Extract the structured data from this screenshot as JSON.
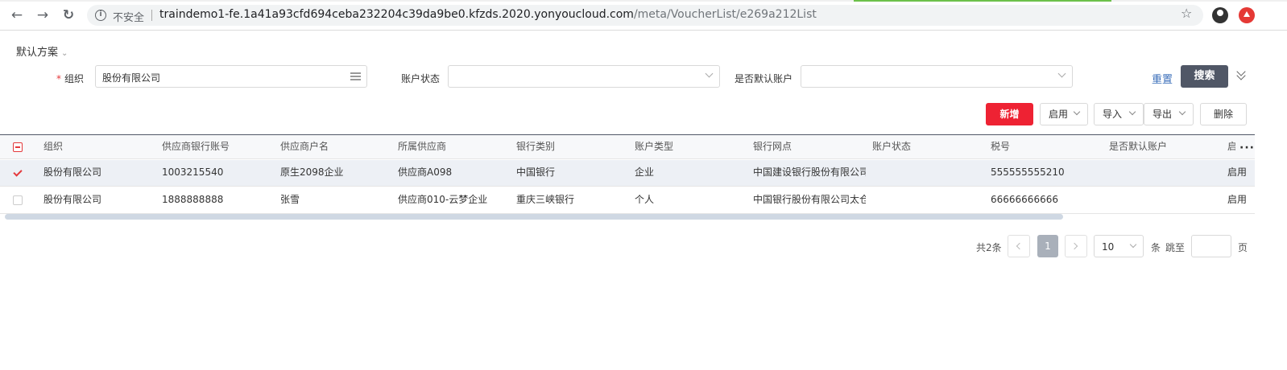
{
  "browser": {
    "security_label": "不安全",
    "url_host": "traindemo1-fe.1a41a93cfd694ceba232204c39da9be0.kfzds.2020.yonyoucloud.com",
    "url_path": "/meta/VoucherList/e269a212List"
  },
  "filters": {
    "scheme_label": "默认方案",
    "org_label": "组织",
    "org_value": "股份有限公司",
    "status_label": "账户状态",
    "status_value": "",
    "default_label": "是否默认账户",
    "default_value": "",
    "reset_label": "重置",
    "search_label": "搜索"
  },
  "toolbar": {
    "add_label": "新增",
    "enable_label": "启用",
    "import_label": "导入",
    "export_label": "导出",
    "delete_label": "删除"
  },
  "table": {
    "columns": [
      "组织",
      "供应商银行账号",
      "供应商户名",
      "所属供应商",
      "银行类别",
      "账户类型",
      "银行网点",
      "账户状态",
      "税号",
      "是否默认账户",
      "启"
    ],
    "rows": [
      {
        "selected": true,
        "cells": [
          "股份有限公司",
          "1003215540",
          "原生2098企业",
          "供应商A098",
          "中国银行",
          "企业",
          "中国建设银行股份有限公司",
          "",
          "555555555210",
          "",
          "启用"
        ]
      },
      {
        "selected": false,
        "cells": [
          "股份有限公司",
          "1888888888",
          "张雪",
          "供应商010-云梦企业",
          "重庆三峡银行",
          "个人",
          "中国银行股份有限公司太仓",
          "",
          "66666666666",
          "",
          "启用"
        ]
      }
    ]
  },
  "pagination": {
    "total_label": "共2条",
    "current_page": "1",
    "page_size": "10",
    "unit_label": "条",
    "jump_label": "跳至",
    "page_label": "页",
    "jump_value": ""
  }
}
